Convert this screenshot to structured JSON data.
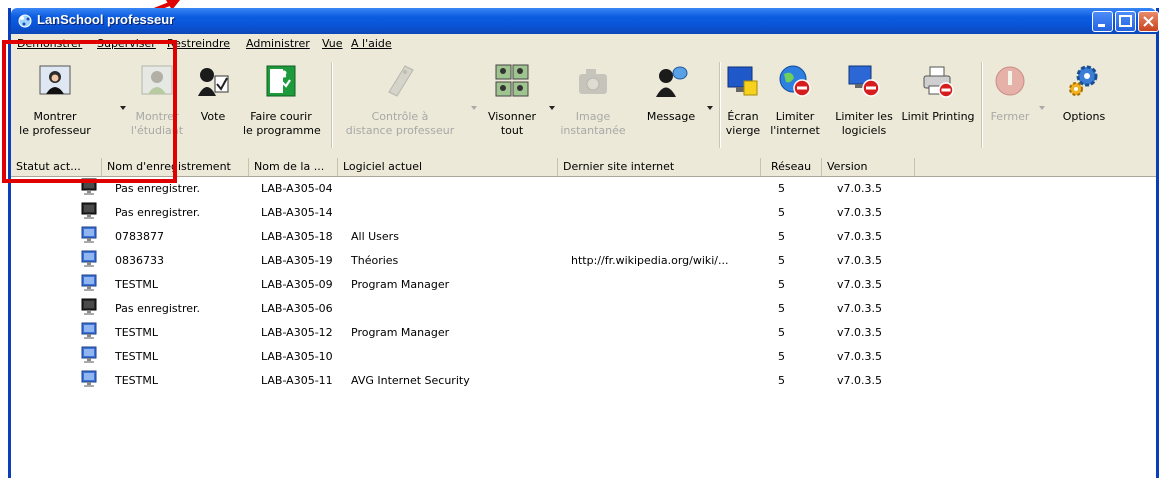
{
  "window": {
    "title": "LanSchool professeur"
  },
  "menu": [
    "Demonstrer",
    "Superviser",
    "Restreindre",
    "Administrer",
    "Vue",
    "A l'aide"
  ],
  "toolbar": [
    {
      "label1": "Montrer",
      "label2": "le professeur",
      "icon": "teacher-icon",
      "disabled": false,
      "dropdown": true
    },
    {
      "label1": "Montrer",
      "label2": "l'étudiant",
      "icon": "student-icon",
      "disabled": true,
      "dropdown": false
    },
    {
      "label1": "Vote",
      "label2": "",
      "icon": "vote-icon",
      "disabled": false,
      "dropdown": false
    },
    {
      "label1": "Faire courir",
      "label2": "le programme",
      "icon": "run-program-icon",
      "disabled": false,
      "dropdown": false
    },
    {
      "label1": "Contrôle à",
      "label2": "distance professeur",
      "icon": "remote-control-icon",
      "disabled": true,
      "dropdown": true
    },
    {
      "label1": "Visonner",
      "label2": "tout",
      "icon": "view-all-icon",
      "disabled": false,
      "dropdown": true
    },
    {
      "label1": "Image",
      "label2": "instantanée",
      "icon": "snapshot-icon",
      "disabled": true,
      "dropdown": false
    },
    {
      "label1": "Message",
      "label2": "",
      "icon": "message-icon",
      "disabled": false,
      "dropdown": true
    },
    {
      "label1": "Écran",
      "label2": "vierge",
      "icon": "blank-screen-icon",
      "disabled": false,
      "dropdown": false
    },
    {
      "label1": "Limiter",
      "label2": "l'internet",
      "icon": "limit-internet-icon",
      "disabled": false,
      "dropdown": false
    },
    {
      "label1": "Limiter les",
      "label2": "logiciels",
      "icon": "limit-software-icon",
      "disabled": false,
      "dropdown": false
    },
    {
      "label1": "Limit Printing",
      "label2": "",
      "icon": "printer-icon",
      "disabled": false,
      "dropdown": false
    },
    {
      "label1": "Fermer",
      "label2": "",
      "icon": "power-icon",
      "disabled": true,
      "dropdown": true
    },
    {
      "label1": "Options",
      "label2": "",
      "icon": "gears-icon",
      "disabled": false,
      "dropdown": false
    }
  ],
  "columns": [
    "Statut act...",
    "Nom d'enregistrement",
    "Nom de la ...",
    "Logiciel actuel",
    "Dernier site internet",
    "Réseau",
    "Version"
  ],
  "rows": [
    {
      "status": "off",
      "name": "Pas enregistrer.",
      "machine": "LAB-A305-04",
      "software": "",
      "site": "",
      "network": "5",
      "version": "v7.0.3.5"
    },
    {
      "status": "off",
      "name": "Pas enregistrer.",
      "machine": "LAB-A305-14",
      "software": "",
      "site": "",
      "network": "5",
      "version": "v7.0.3.5"
    },
    {
      "status": "on",
      "name": "0783877",
      "machine": "LAB-A305-18",
      "software": "All Users",
      "site": "",
      "network": "5",
      "version": "v7.0.3.5"
    },
    {
      "status": "on",
      "name": "0836733",
      "machine": "LAB-A305-19",
      "software": "Théories",
      "site": "http://fr.wikipedia.org/wiki/...",
      "network": "5",
      "version": "v7.0.3.5"
    },
    {
      "status": "on",
      "name": "TESTML",
      "machine": "LAB-A305-09",
      "software": "Program Manager",
      "site": "",
      "network": "5",
      "version": "v7.0.3.5"
    },
    {
      "status": "off",
      "name": "Pas enregistrer.",
      "machine": "LAB-A305-06",
      "software": "",
      "site": "",
      "network": "5",
      "version": "v7.0.3.5"
    },
    {
      "status": "on",
      "name": "TESTML",
      "machine": "LAB-A305-12",
      "software": "Program Manager",
      "site": "",
      "network": "5",
      "version": "v7.0.3.5"
    },
    {
      "status": "on",
      "name": "TESTML",
      "machine": "LAB-A305-10",
      "software": "",
      "site": "",
      "network": "5",
      "version": "v7.0.3.5"
    },
    {
      "status": "on",
      "name": "TESTML",
      "machine": "LAB-A305-11",
      "software": "AVG Internet Security",
      "site": "",
      "network": "5",
      "version": "v7.0.3.5"
    }
  ],
  "colors": {
    "highlight": "#e00000",
    "titlebar": "#0a53d6"
  }
}
